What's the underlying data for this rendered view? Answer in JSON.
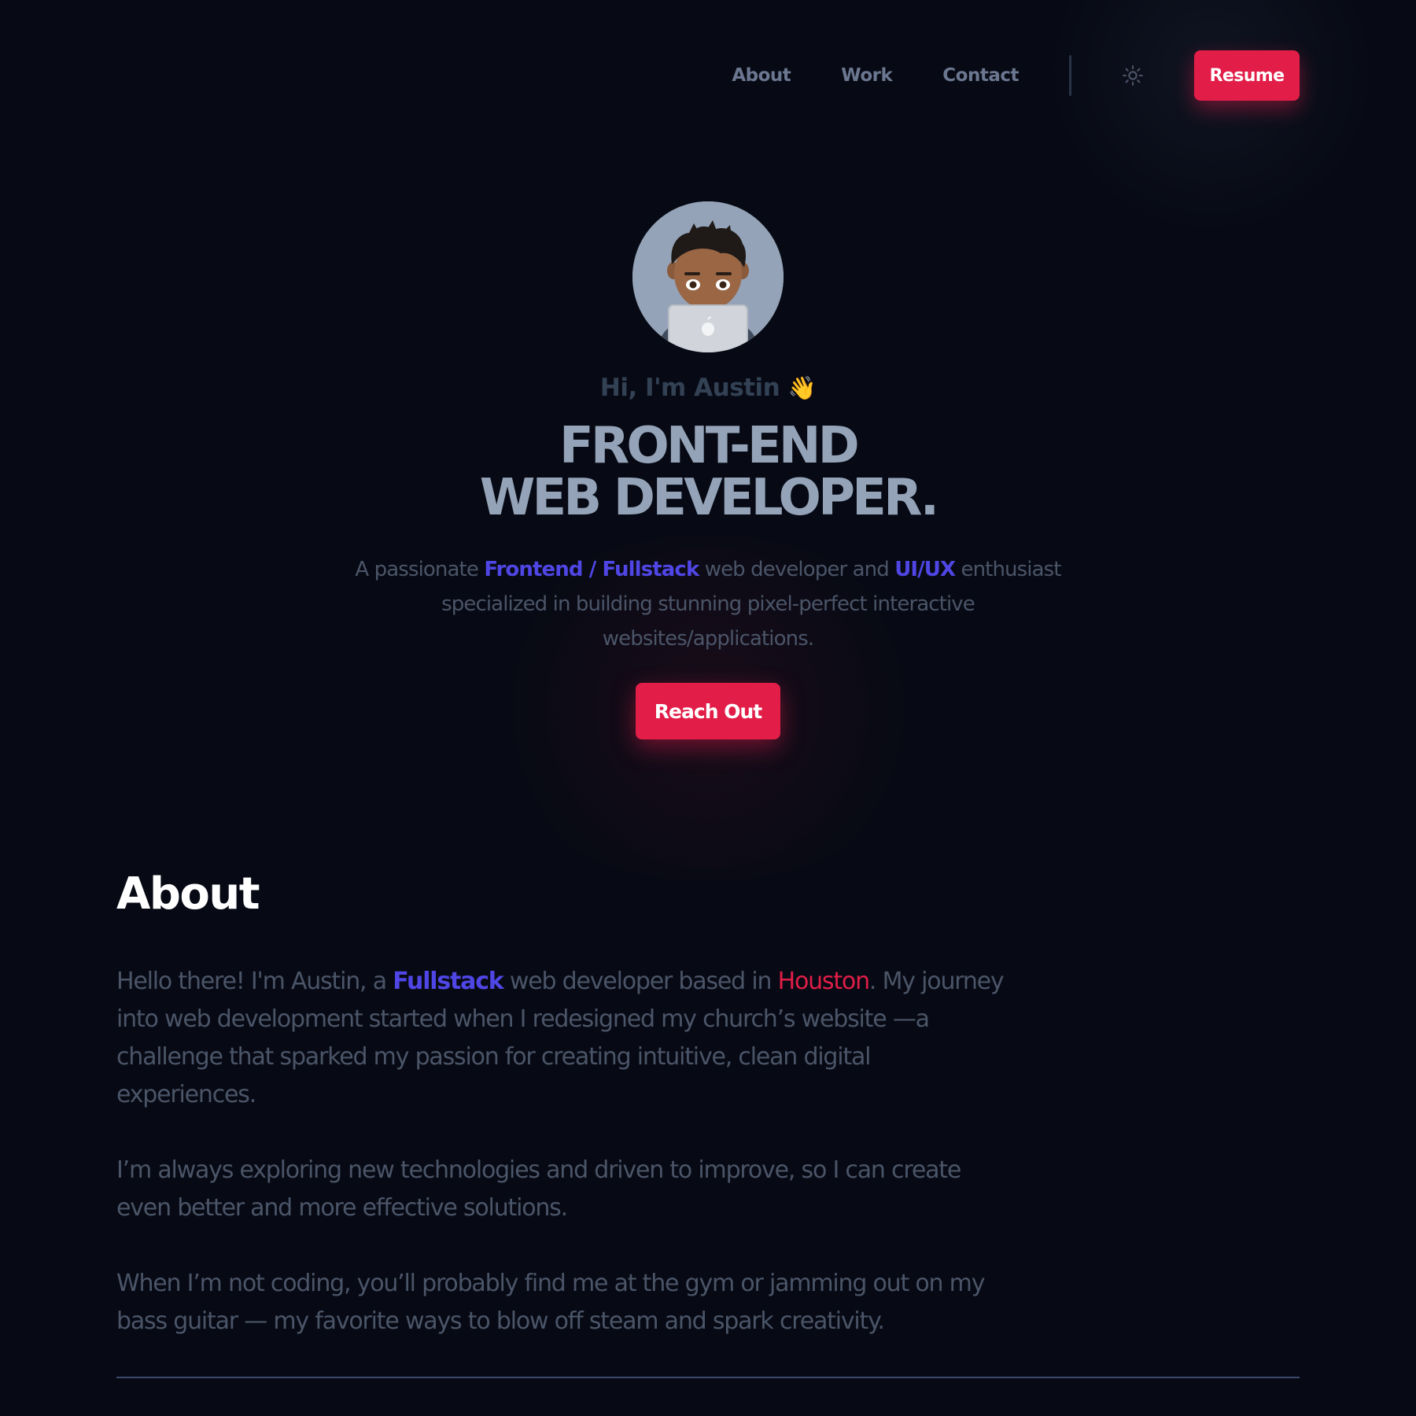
{
  "nav": {
    "links": [
      "About",
      "Work",
      "Contact"
    ],
    "theme_icon": "sun-icon",
    "resume_label": "Resume"
  },
  "hero": {
    "avatar_icon": "memoji-avatar-with-laptop",
    "greeting": "Hi, I'm Austin",
    "greeting_emoji": "👋",
    "headline_line1": "FRONT-END",
    "headline_line2": "WEB DEVELOPER.",
    "tagline": {
      "t1": "A passionate ",
      "h1": "Frontend / Fullstack",
      "t2": " web developer and ",
      "h2": "UI/UX",
      "t3": " enthusiast specialized in building stunning pixel-perfect interactive websites/applications."
    },
    "cta_label": "Reach Out"
  },
  "about": {
    "title": "About",
    "p1": {
      "t1": "Hello there! I'm Austin, a ",
      "h1": "Fullstack",
      "t2": " web developer based in ",
      "h2": "Houston",
      "t3": ". My journey into web development started when I redesigned my church’s website —a challenge that sparked my passion for creating intuitive, clean digital experiences."
    },
    "p2": "I’m always exploring new technologies and driven to improve, so I can create even better and more effective solutions.",
    "p3": "When I’m not coding, you’ll probably find me at the gym or jamming out on my bass guitar — my favorite ways to blow off steam and spark creativity."
  },
  "colors": {
    "background": "#070a14",
    "accent_rose": "#e11d48",
    "accent_indigo": "#4f46e5",
    "heading_slate": "#94a3b8"
  }
}
